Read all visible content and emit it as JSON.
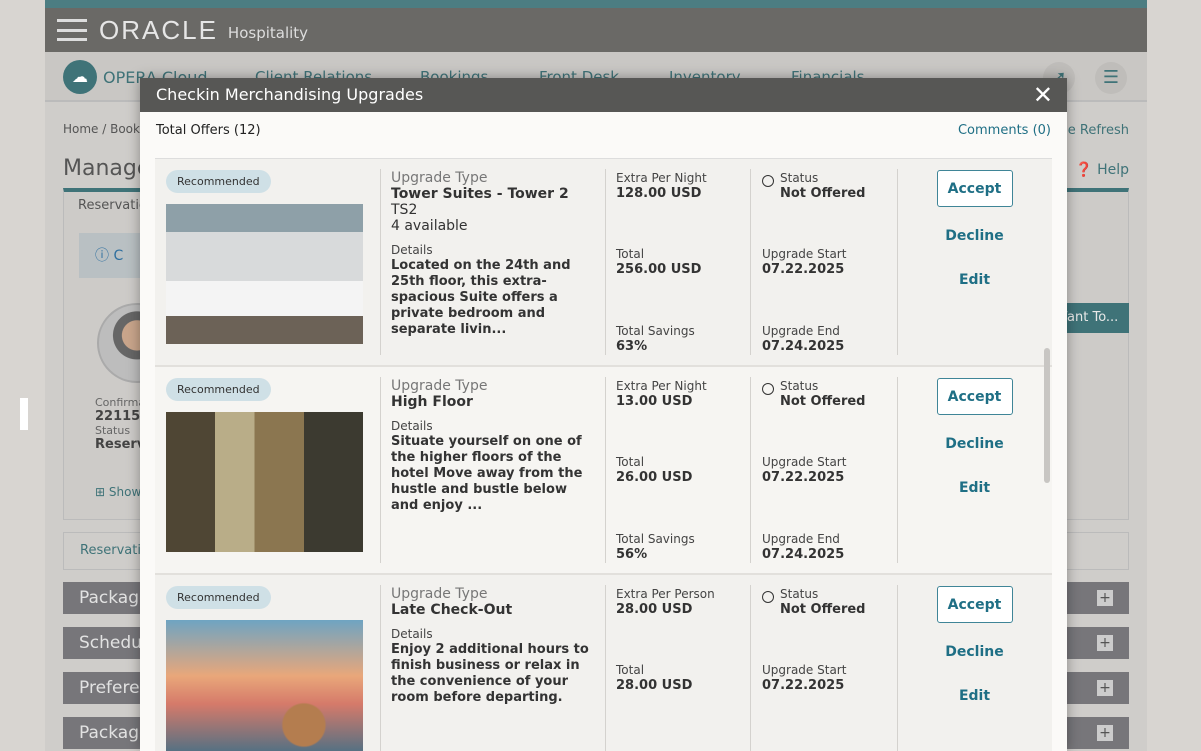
{
  "app": {
    "brand": "ORACLE",
    "brand_sub": "Hospitality",
    "product": "OPERA Cloud"
  },
  "nav": [
    "Client Relations",
    "Bookings",
    "Front Desk",
    "Inventory",
    "Financials"
  ],
  "page": {
    "breadcrumb": "Home / Bookin",
    "refresh": "ge Refresh",
    "title": "Manage",
    "help": "Help",
    "reservation_tab": "Reservatio",
    "info": "C",
    "confirmation_label": "Confirma",
    "confirmation": "22115",
    "status_label": "Status",
    "status": "Reserv",
    "show": "Show",
    "i_want_to": "Want To...",
    "reservation_link": "Reservatio",
    "accordions": [
      "Package",
      "Schedul",
      "Preferer",
      "Package"
    ]
  },
  "dialog": {
    "title": "Checkin Merchandising Upgrades",
    "total_offers": "Total Offers (12)",
    "comments": "Comments (0)",
    "offers": [
      {
        "badge": "Recommended",
        "type_label": "Upgrade Type",
        "type": "Tower Suites - Tower 2",
        "code": "TS2",
        "availability": "4 available",
        "details_label": "Details",
        "details": "Located on the 24th and 25th floor, this extra-spacious Suite offers a private bedroom and separate livin...",
        "price_label": "Extra Per Night",
        "price": "128.00 USD",
        "total_label": "Total",
        "total": "256.00 USD",
        "savings_label": "Total Savings",
        "savings": "63%",
        "status_label": "Status",
        "status": "Not Offered",
        "start_label": "Upgrade Start",
        "start": "07.22.2025",
        "end_label": "Upgrade End",
        "end": "07.24.2025",
        "accept": "Accept",
        "decline": "Decline",
        "edit": "Edit"
      },
      {
        "badge": "Recommended",
        "type_label": "Upgrade Type",
        "type": "High Floor",
        "details_label": "Details",
        "details": "Situate yourself on one of the higher floors of the hotel Move away from the hustle and bustle below and enjoy ...",
        "price_label": "Extra Per Night",
        "price": "13.00 USD",
        "total_label": "Total",
        "total": "26.00 USD",
        "savings_label": "Total Savings",
        "savings": "56%",
        "status_label": "Status",
        "status": "Not Offered",
        "start_label": "Upgrade Start",
        "start": "07.22.2025",
        "end_label": "Upgrade End",
        "end": "07.24.2025",
        "accept": "Accept",
        "decline": "Decline",
        "edit": "Edit"
      },
      {
        "badge": "Recommended",
        "type_label": "Upgrade Type",
        "type": "Late Check-Out",
        "details_label": "Details",
        "details": "Enjoy 2 additional hours to finish business or relax in the convenience of your room before departing.",
        "price_label": "Extra Per Person",
        "price": "28.00 USD",
        "total_label": "Total",
        "total": "28.00 USD",
        "status_label": "Status",
        "status": "Not Offered",
        "start_label": "Upgrade Start",
        "start": "07.22.2025",
        "accept": "Accept",
        "decline": "Decline",
        "edit": "Edit"
      }
    ]
  }
}
